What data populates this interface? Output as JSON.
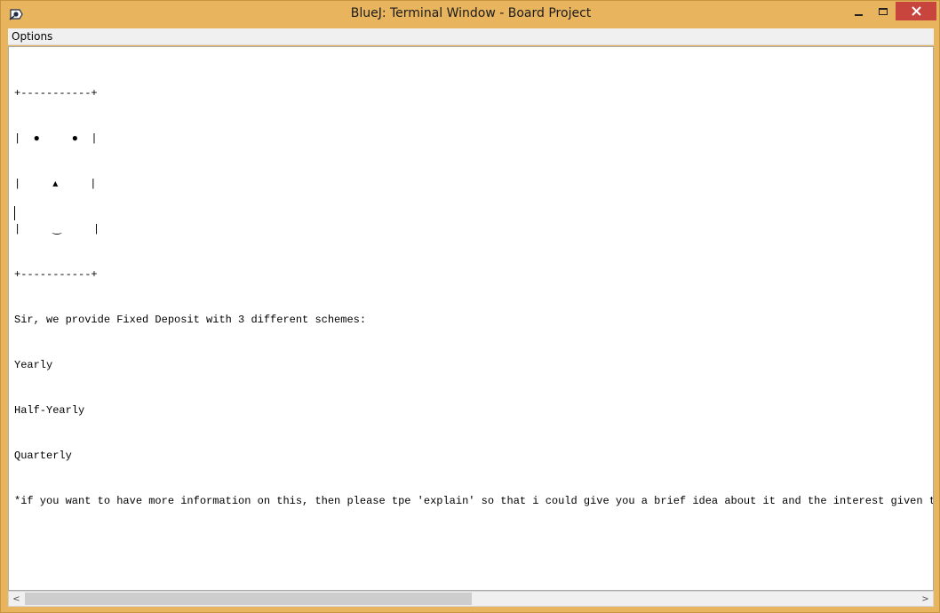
{
  "window": {
    "title": "BlueJ: Terminal Window - Board Project",
    "close_glyph": "✕"
  },
  "menu": {
    "options_label": "Options"
  },
  "terminal": {
    "lines": [
      "+-----------+",
      "|  ●     ●  |",
      "|     ▴     |",
      "|     ‿     |",
      "+-----------+",
      "Sir, we provide Fixed Deposit with 3 different schemes:",
      "Yearly",
      "Half-Yearly",
      "Quarterly",
      "*if you want to have more information on this, then please tpe 'explain' so that i could give you a brief idea about it and the interest given too*"
    ]
  },
  "scrollbar": {
    "left_arrow": "<",
    "right_arrow": ">",
    "thumb_fraction": 0.5
  },
  "icons": {
    "app": "bluej-app-icon",
    "minimize": "minimize-icon",
    "maximize": "maximize-icon",
    "close": "close-icon"
  },
  "colors": {
    "window_frame": "#e8b55e",
    "close_button": "#c7453d",
    "terminal_bg": "#ffffff"
  }
}
